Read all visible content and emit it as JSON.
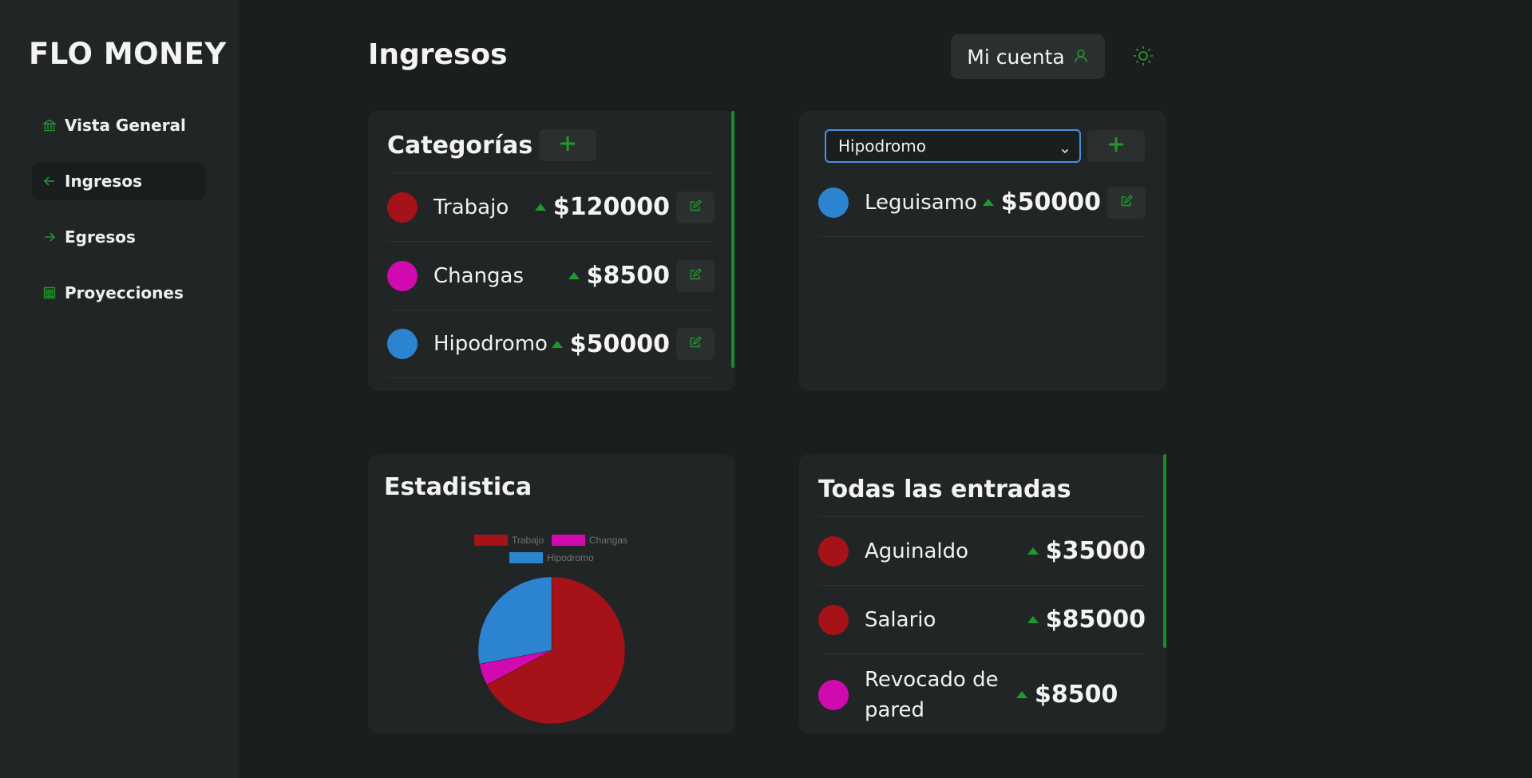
{
  "app": {
    "brand": "FLO MONEY",
    "page_title": "Ingresos"
  },
  "sidebar": {
    "items": [
      {
        "label": "Vista General",
        "icon": "bank-icon"
      },
      {
        "label": "Ingresos",
        "icon": "arrow-left-icon",
        "active": true
      },
      {
        "label": "Egresos",
        "icon": "arrow-right-icon"
      },
      {
        "label": "Proyecciones",
        "icon": "table-icon"
      }
    ]
  },
  "header": {
    "account_label": "Mi cuenta",
    "theme_icon": "sun-icon"
  },
  "categories": {
    "title": "Categorías",
    "items": [
      {
        "name": "Trabajo",
        "amount": "$120000",
        "color": "#a51218"
      },
      {
        "name": "Changas",
        "amount": "$8500",
        "color": "#d10aaf"
      },
      {
        "name": "Hipodromo",
        "amount": "$50000",
        "color": "#2c84d0"
      }
    ]
  },
  "subcategories": {
    "selected": "Hipodromo",
    "items": [
      {
        "name": "Leguisamo",
        "amount": "$50000",
        "color": "#2c84d0"
      }
    ]
  },
  "stats": {
    "title": "Estadistica",
    "chart_data": {
      "type": "pie",
      "categories": [
        "Trabajo",
        "Changas",
        "Hipodromo"
      ],
      "values": [
        120000,
        8500,
        50000
      ],
      "colors": [
        "#a51218",
        "#d10aaf",
        "#2c84d0"
      ],
      "legend": "top"
    }
  },
  "all_entries": {
    "title": "Todas las entradas",
    "items": [
      {
        "name": "Aguinaldo",
        "amount": "$35000",
        "color": "#a51218"
      },
      {
        "name": "Salario",
        "amount": "$85000",
        "color": "#a51218"
      },
      {
        "name": "Revocado de pared",
        "amount": "$8500",
        "color": "#d10aaf"
      }
    ]
  },
  "colors": {
    "accent": "#1e9a2c",
    "background": "#1b1e1f",
    "panel": "#212526"
  }
}
